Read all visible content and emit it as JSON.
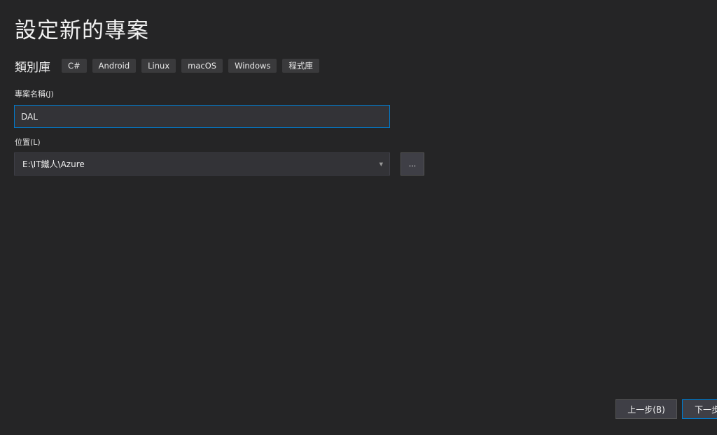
{
  "page": {
    "title": "設定新的專案"
  },
  "template": {
    "name": "類別庫",
    "tags": [
      "C#",
      "Android",
      "Linux",
      "macOS",
      "Windows",
      "程式庫"
    ]
  },
  "project_name": {
    "label": "專案名稱(J)",
    "value": "DAL"
  },
  "location": {
    "label": "位置(L)",
    "value": "E:\\IT鐵人\\Azure",
    "browse_label": "..."
  },
  "footer": {
    "back_label": "上一步(B)",
    "next_label": "下一步"
  },
  "colors": {
    "background": "#252526",
    "accent": "#007acc"
  }
}
